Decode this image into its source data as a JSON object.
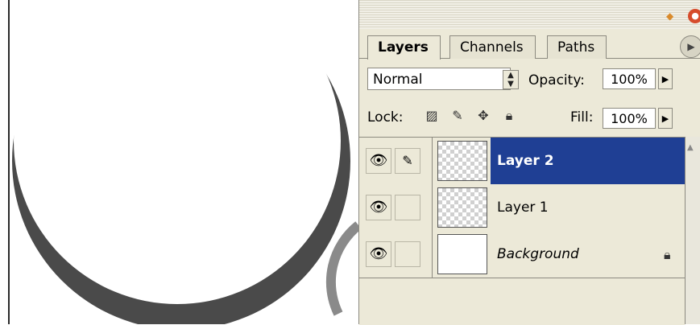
{
  "panel": {
    "tabs": [
      {
        "label": "Layers"
      },
      {
        "label": "Channels"
      },
      {
        "label": "Paths"
      }
    ],
    "blend_mode": "Normal",
    "opacity_label": "Opacity:",
    "opacity_value": "100%",
    "lock_label": "Lock:",
    "fill_label": "Fill:",
    "fill_value": "100%",
    "layers": [
      {
        "name": "Layer 2",
        "selected": true
      },
      {
        "name": "Layer 1",
        "selected": false
      },
      {
        "name": "Background",
        "selected": false,
        "locked": true
      }
    ]
  },
  "colors": {
    "selection": "#1f3f94",
    "panel_bg": "#ece9d8",
    "crescent": "#4a4a4a"
  },
  "icons": {
    "visibility": "eye-icon",
    "paint": "brush-icon",
    "lock_transparent": "checker-icon",
    "lock_image": "brush-icon",
    "lock_position": "move-icon",
    "lock_all": "lock-icon"
  }
}
